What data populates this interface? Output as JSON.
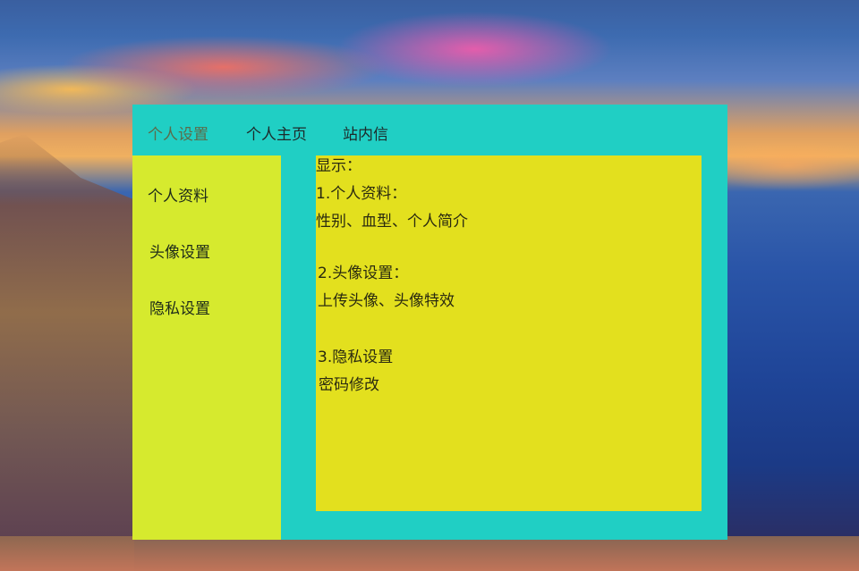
{
  "colors": {
    "panel": "#20cfc4",
    "sidebar": "#d6ea2e",
    "content": "#e3e01e",
    "text": "#1d2a2a"
  },
  "nav": {
    "items": [
      {
        "label": "个人设置",
        "active": true
      },
      {
        "label": "个人主页",
        "active": false
      },
      {
        "label": "站内信",
        "active": false
      }
    ]
  },
  "sidebar": {
    "items": [
      {
        "label": "个人资料"
      },
      {
        "label": "头像设置"
      },
      {
        "label": "隐私设置"
      }
    ]
  },
  "content": {
    "heading": "显示：",
    "sections": [
      {
        "title": "1.个人资料：",
        "detail": "性别、血型、个人简介"
      },
      {
        "title": "2.头像设置：",
        "detail": "上传头像、头像特效"
      },
      {
        "title": "3.隐私设置",
        "detail": "密码修改"
      }
    ]
  }
}
